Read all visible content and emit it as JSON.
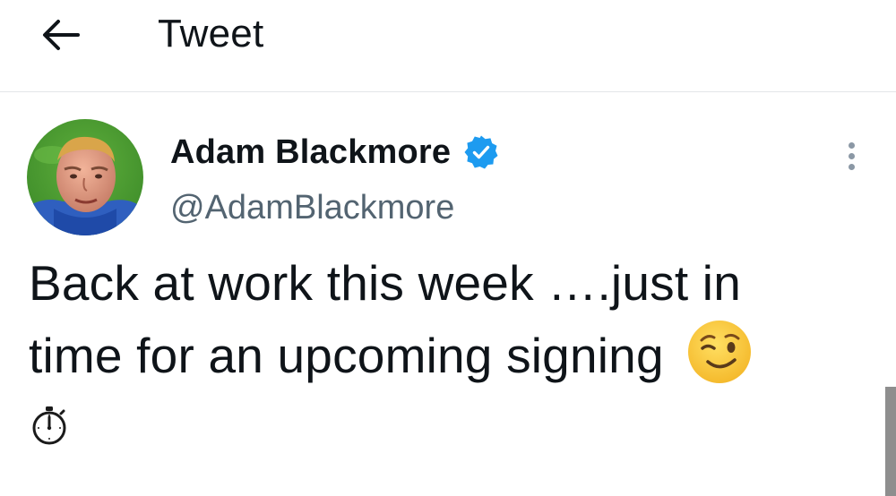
{
  "header": {
    "back_icon": "arrow-left-icon",
    "title": "Tweet"
  },
  "author": {
    "name": "Adam Blackmore",
    "handle": "@AdamBlackmore",
    "verified": true,
    "verified_icon": "verified-badge-icon",
    "avatar": "avatar-photo"
  },
  "menu": {
    "icon": "more-vertical-icon"
  },
  "tweet": {
    "line1": "Back at work this week ….just in",
    "line2": "time for an upcoming signing ",
    "emoji_1": "winking-face-emoji",
    "emoji_2": "stopwatch-emoji"
  },
  "colors": {
    "text": "#0f1419",
    "secondary_text": "#536471",
    "verified_blue": "#1d9bf0",
    "divider": "#e3e6e8"
  }
}
